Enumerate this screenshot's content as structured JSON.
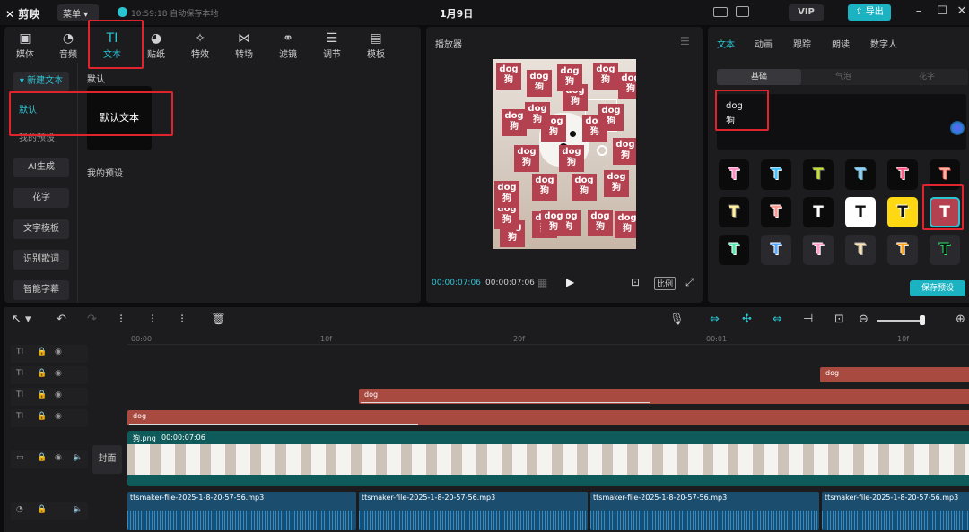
{
  "titlebar": {
    "app_name": "剪映",
    "menu_label": "菜单",
    "save_status": "10:59:18 自动保存本地",
    "doc_title": "1月9日",
    "vip_label": "VIP",
    "export_label": "导出"
  },
  "toolbar": {
    "tabs": [
      {
        "label": "媒体",
        "icon": "media-icon"
      },
      {
        "label": "音频",
        "icon": "audio-icon"
      },
      {
        "label": "文本",
        "icon": "text-icon"
      },
      {
        "label": "贴纸",
        "icon": "sticker-icon"
      },
      {
        "label": "特效",
        "icon": "effects-icon"
      },
      {
        "label": "转场",
        "icon": "transition-icon"
      },
      {
        "label": "滤镜",
        "icon": "filter-icon"
      },
      {
        "label": "调节",
        "icon": "adjust-icon"
      },
      {
        "label": "模板",
        "icon": "template-icon"
      }
    ]
  },
  "left_sidebar": {
    "items": [
      "新建文本",
      "默认",
      "我的预设",
      "AI生成",
      "花字",
      "文字模板",
      "识别歌词",
      "智能字幕"
    ]
  },
  "content": {
    "section_default": "默认",
    "default_text_card": "默认文本",
    "section_my_presets": "我的预设"
  },
  "player": {
    "title": "播放器",
    "current_time": "00:00:07:06",
    "total_time": "00:00:07:06",
    "ratio_label": "比例",
    "sticker_texts": [
      "dog",
      "狗"
    ]
  },
  "right_panel": {
    "tabs": [
      "文本",
      "动画",
      "跟踪",
      "朗读",
      "数字人"
    ],
    "sub_tabs": [
      "基础",
      "气泡",
      "花字"
    ],
    "text_value": [
      "dog",
      "狗"
    ],
    "save_preset_label": "保存预设",
    "style_tile_letter": "T"
  },
  "timeline": {
    "ruler": [
      "00:00",
      "10f",
      "20f",
      "00:01",
      "10f"
    ],
    "text_clips": [
      "dog",
      "dog",
      "dog"
    ],
    "video_clip": {
      "name": "狗.png",
      "duration": "00:00:07:06"
    },
    "cover_label": "封面",
    "audio_clips": [
      "ttsmaker-file-2025-1-8-20-57-56.mp3",
      "ttsmaker-file-2025-1-8-20-57-56.mp3",
      "ttsmaker-file-2025-1-8-20-57-56.mp3",
      "ttsmaker-file-2025-1-8-20-57-56.mp3"
    ]
  },
  "colors": {
    "accent": "#29c5d3",
    "highlight": "#e0242d",
    "text_clip": "#a84a40",
    "audio_clip": "#1a4d6e"
  }
}
